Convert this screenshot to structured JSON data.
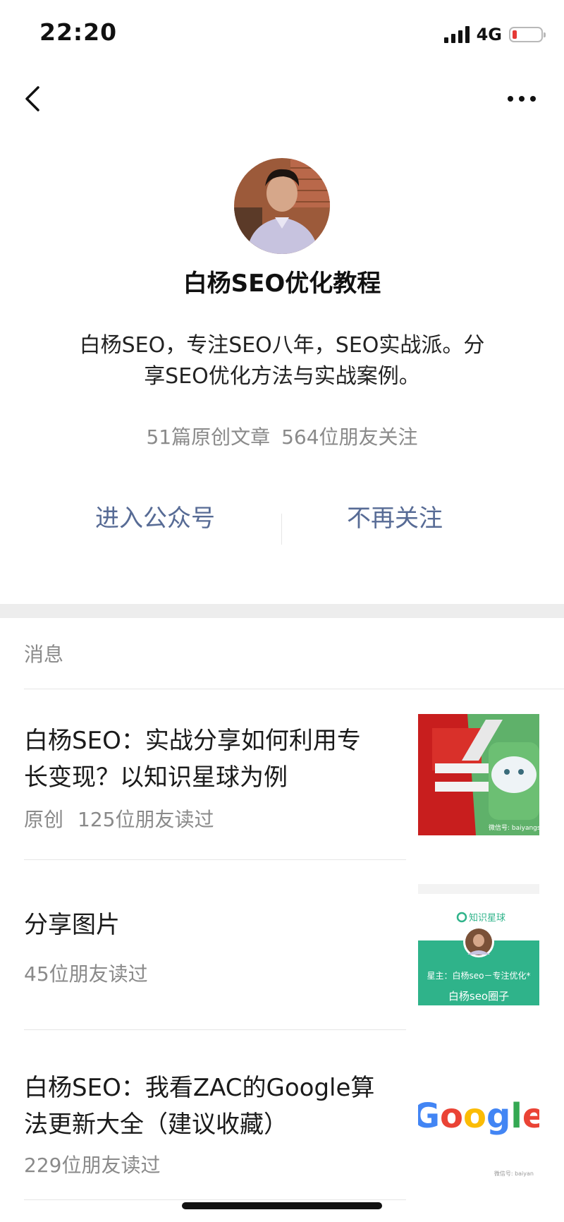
{
  "status_bar": {
    "time": "22:20",
    "network": "4G",
    "battery_level": 0.15,
    "battery_color": "#e53935"
  },
  "nav": {
    "back_icon": "chevron-left-icon",
    "more_icon": "more-dots-icon"
  },
  "profile": {
    "name": "白杨SEO优化教程",
    "description_line1": "白杨SEO，专注SEO八年，SEO实战派。分",
    "description_line2": "享SEO优化方法与实战案例。",
    "articles": "51篇原创文章",
    "followers": "564位朋友关注",
    "enter_button": "进入公众号",
    "unfollow_button": "不再关注",
    "link_color": "#576b95"
  },
  "messages": {
    "section_title": "消息",
    "items": [
      {
        "title_line1": "白杨SEO：实战分享如何利用专",
        "title_line2": "长变现？以知识星球为例",
        "tag": "原创",
        "reads": "125位朋友读过",
        "thumb_watermark": "微信号: baiyangseo"
      },
      {
        "title_line1": "分享图片",
        "reads": "45位朋友读过",
        "thumb_header": "知识星球",
        "thumb_caption": "星主：白杨seo－专注优化*",
        "thumb_subcaption": "白杨seo圈子"
      },
      {
        "title_line1": "白杨SEO：我看ZAC的Google算",
        "title_line2": "法更新大全（建议收藏）",
        "reads": "229位朋友读过",
        "thumb_logo": "Google",
        "thumb_watermark": "微信号: baiyan"
      }
    ]
  }
}
